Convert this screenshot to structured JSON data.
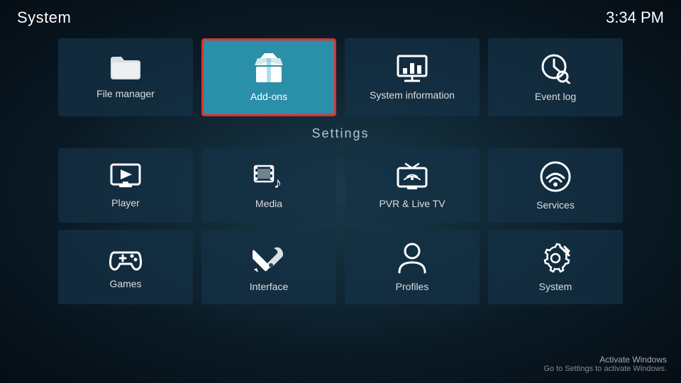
{
  "header": {
    "title": "System",
    "clock": "3:34 PM"
  },
  "quick_items": [
    {
      "id": "file-manager",
      "label": "File manager",
      "icon": "folder"
    },
    {
      "id": "add-ons",
      "label": "Add-ons",
      "icon": "box",
      "active": true
    },
    {
      "id": "system-information",
      "label": "System information",
      "icon": "presentation"
    },
    {
      "id": "event-log",
      "label": "Event log",
      "icon": "clock-search"
    }
  ],
  "settings_section": {
    "title": "Settings",
    "items_row1": [
      {
        "id": "player",
        "label": "Player",
        "icon": "monitor-play"
      },
      {
        "id": "media",
        "label": "Media",
        "icon": "media"
      },
      {
        "id": "pvr-live-tv",
        "label": "PVR & Live TV",
        "icon": "tv"
      },
      {
        "id": "services",
        "label": "Services",
        "icon": "wifi-circle"
      }
    ],
    "items_row2": [
      {
        "id": "games",
        "label": "Games",
        "icon": "gamepad"
      },
      {
        "id": "interface",
        "label": "Interface",
        "icon": "wrench-pencil"
      },
      {
        "id": "profiles",
        "label": "Profiles",
        "icon": "person"
      },
      {
        "id": "system",
        "label": "System",
        "icon": "gear-wrench"
      }
    ]
  },
  "watermark": {
    "title": "Activate Windows",
    "subtitle": "Go to Settings to activate Windows."
  }
}
